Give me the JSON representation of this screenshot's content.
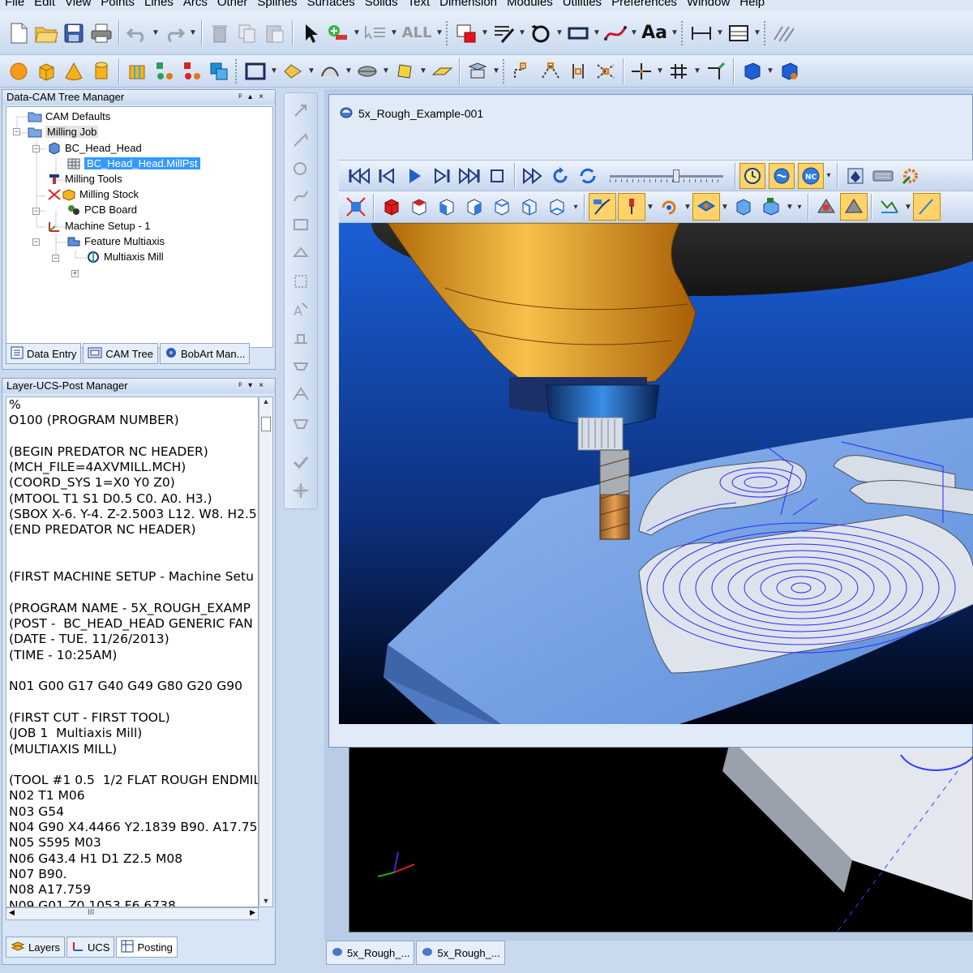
{
  "menu": [
    "File",
    "Edit",
    "View",
    "Points",
    "Lines",
    "Arcs",
    "Other",
    "Splines",
    "Surfaces",
    "Solids",
    "Text",
    "Dimension",
    "Modules",
    "Utilities",
    "Preferences",
    "Window",
    "Help"
  ],
  "toolbar": {
    "all_label": "ALL",
    "text_label": "Aa"
  },
  "tree_panel": {
    "title": "Data-CAM Tree Manager",
    "nodes": [
      {
        "label": "CAM Defaults"
      },
      {
        "label": "Milling Job"
      },
      {
        "label": "BC_Head_Head"
      },
      {
        "label": "BC_Head_Head.MillPst"
      },
      {
        "label": "Milling Tools"
      },
      {
        "label": "Milling Stock"
      },
      {
        "label": "PCB Board"
      },
      {
        "label": "Machine Setup - 1"
      },
      {
        "label": "Feature Multiaxis"
      },
      {
        "label": "Multiaxis Mill"
      }
    ],
    "tabs": [
      "Data Entry",
      "CAM Tree",
      "BobArt Man..."
    ]
  },
  "post_panel": {
    "title": "Layer-UCS-Post Manager",
    "lines": [
      "%",
      "O100 (PROGRAM NUMBER)",
      "",
      "(BEGIN PREDATOR NC HEADER)",
      "(MCH_FILE=4AXVMILL.MCH)",
      "(COORD_SYS 1=X0 Y0 Z0)",
      "(MTOOL T1 S1 D0.5 C0. A0. H3.)",
      "(SBOX X-6. Y-4. Z-2.5003 L12. W8. H2.5",
      "(END PREDATOR NC HEADER)",
      "",
      "",
      "(FIRST MACHINE SETUP - Machine Setu",
      "",
      "(PROGRAM NAME - 5X_ROUGH_EXAMP",
      "(POST -  BC_HEAD_HEAD GENERIC FAN",
      "(DATE - TUE. 11/26/2013)",
      "(TIME - 10:25AM)",
      "",
      "N01 G00 G17 G40 G49 G80 G20 G90",
      "",
      "(FIRST CUT - FIRST TOOL)",
      "(JOB 1  Multiaxis Mill)",
      "(MULTIAXIS MILL)",
      "",
      "(TOOL #1 0.5  1/2 FLAT ROUGH ENDMIL",
      "N02 T1 M06",
      "N03 G54",
      "N04 G90 X4.4466 Y2.1839 B90. A17.75",
      "N05 S595 M03",
      "N06 G43.4 H1 D1 Z2.5 M08",
      "N07 B90.",
      "N08 A17.759",
      "N09 G01 Z0.1053 F6.6738"
    ],
    "scroll_mid": "III",
    "tabs": [
      "Layers",
      "UCS",
      "Posting"
    ]
  },
  "window": {
    "title": "5x_Rough_Example-001"
  },
  "doc_tabs": [
    "5x_Rough_...",
    "5x_Rough_..."
  ],
  "colors": {
    "viewport_top": "#1a5fd6",
    "viewport_bottom": "#00040f",
    "part": "#7fa8e6",
    "toolpath": "#1a1aff",
    "holder": "#e8a41e",
    "selection": "#3399ff"
  }
}
